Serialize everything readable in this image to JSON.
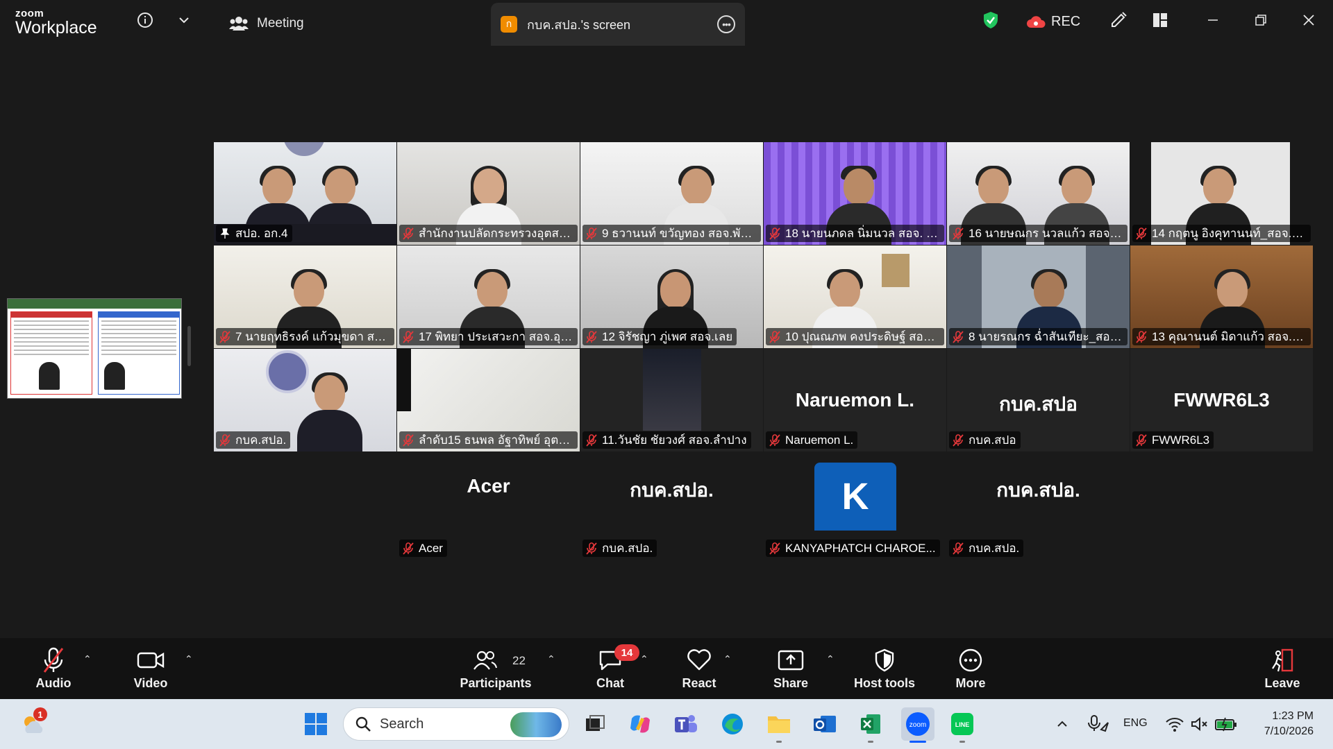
{
  "app": {
    "brand_small": "zoom",
    "brand_big": "Workplace",
    "meeting_label": "Meeting",
    "share_tab": {
      "badge": "ก",
      "title": "กบค.สปอ.'s screen"
    },
    "rec_label": "REC"
  },
  "grid": {
    "row1": [
      {
        "name": "สปอ. อก.4",
        "pinned": true
      },
      {
        "name": "สำนักงานปลัดกระทรวงอุตสาห..."
      },
      {
        "name": "9 ธวานนท์ ขวัญทอง สอจ.พัทลุง"
      },
      {
        "name": "18 นายนภดล นิ่มนวล สอจ. อุ..."
      },
      {
        "name": "16 นายษณกร นวลแก้ว สอจ.ส..."
      },
      {
        "name": "14 กฤตนู อิงคุทานนท์_สอจ.สร..."
      }
    ],
    "row2": [
      {
        "name": "7 นายฤทธิรงค์ แก้วมุขดา สอจ..."
      },
      {
        "name": "17 พิทยา ประเสวะกา สอจ.อุด..."
      },
      {
        "name": "12 จิรัชญา ภู่เพศ สอจ.เลย"
      },
      {
        "name": "10 ปุณณภพ คงประดิษฐ์ สอจ...."
      },
      {
        "name": "8 นายรณกร ฉ่ำสันเทียะ_สอจ...."
      },
      {
        "name": "13 คุณานนต์ มิดาแก้ว สอจ.ส..."
      }
    ],
    "row3": [
      {
        "name": "กบค.สปอ."
      },
      {
        "name": "ลำดับ15 ธนพล อัฐาทิพย์ อุตส..."
      },
      {
        "name": "11.วันชัย ชัยวงศ์ สอจ.ลำปาง"
      },
      {
        "name": "Naruemon L.",
        "big": "Naruemon L."
      },
      {
        "name": "กบค.สปอ",
        "big": "กบค.สปอ"
      },
      {
        "name": "FWWR6L3",
        "big": "FWWR6L3"
      }
    ],
    "row4": [
      {
        "name": "Acer",
        "big": "Acer"
      },
      {
        "name": "กบค.สปอ.",
        "big": "กบค.สปอ."
      },
      {
        "name": "KANYAPHATCH CHAROE...",
        "avatar": "K"
      },
      {
        "name": "กบค.สปอ.",
        "big": "กบค.สปอ."
      }
    ]
  },
  "toolbar": {
    "audio": "Audio",
    "video": "Video",
    "participants": "Participants",
    "participants_count": "22",
    "chat": "Chat",
    "chat_badge": "14",
    "react": "React",
    "share": "Share",
    "host_tools": "Host tools",
    "more": "More",
    "leave": "Leave"
  },
  "taskbar": {
    "search_placeholder": "Search",
    "weather_badge": "1",
    "lang": "ENG",
    "time": "1:23 PM",
    "date": "7/10/2026"
  },
  "colors": {
    "active_speaker": "#2fd17b",
    "mute_red": "#e5383b",
    "chat_badge": "#e5383b",
    "avatar_blue": "#0e5fb8",
    "share_badge": "#f08c00"
  }
}
